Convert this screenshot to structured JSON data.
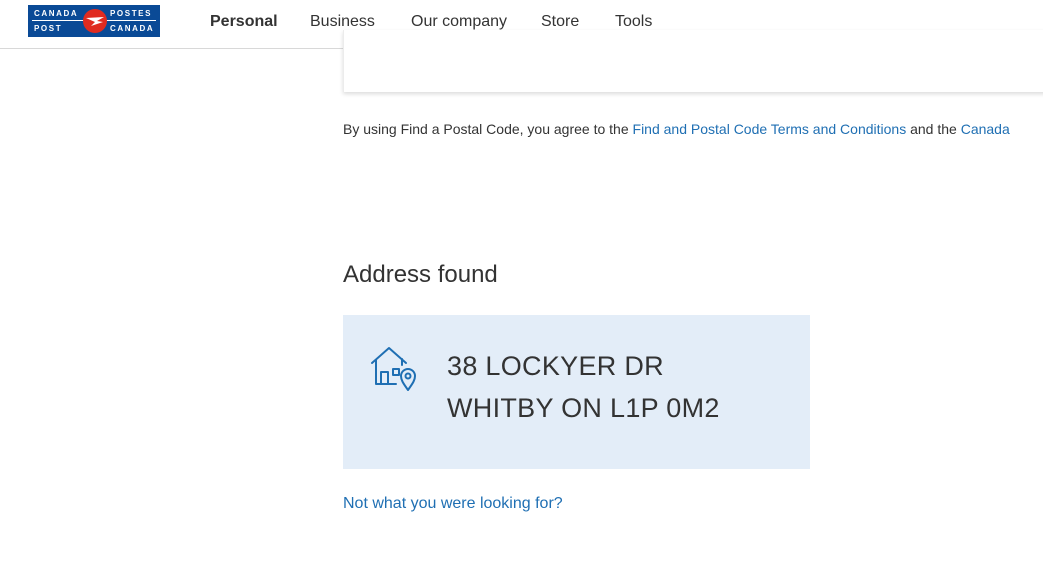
{
  "header": {
    "logo": {
      "words": [
        "CANADA",
        "POST",
        "POSTES",
        "CANADA"
      ],
      "colors": {
        "background": "#0a4a96",
        "seal": "#e02b20"
      }
    },
    "nav": [
      {
        "label": "Personal",
        "active": true
      },
      {
        "label": "Business",
        "active": false
      },
      {
        "label": "Our company",
        "active": false
      },
      {
        "label": "Store",
        "active": false
      },
      {
        "label": "Tools",
        "active": false
      }
    ]
  },
  "terms": {
    "prefix": "By using Find a Postal Code, you agree to the ",
    "link1": "Find and Postal Code Terms and Conditions",
    "middle": " and the ",
    "link2": "Canada"
  },
  "result": {
    "heading": "Address found",
    "icon": "house-location-icon",
    "address_line1": "38 LOCKYER DR",
    "address_line2": "WHITBY ON L1P 0M2",
    "background": "#e3edf8"
  },
  "help_link": "Not what you were looking for?",
  "colors": {
    "link": "#1f6fb3",
    "text": "#333333",
    "icon": "#1f6fb3"
  }
}
